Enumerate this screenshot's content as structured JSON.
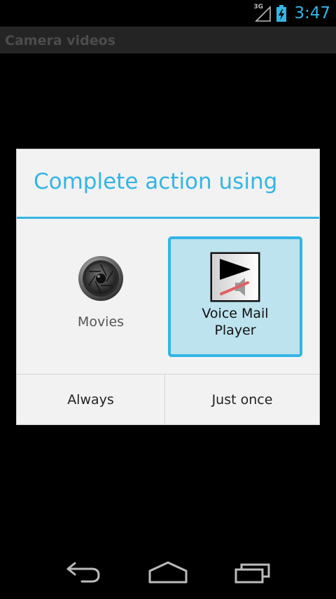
{
  "status_bar": {
    "network_type": "3G",
    "time": "3:47",
    "accent_color": "#33b5e5"
  },
  "action_bar": {
    "title": "Camera videos"
  },
  "dialog": {
    "title": "Complete action using",
    "apps": [
      {
        "label": "Movies",
        "icon": "movies-icon",
        "selected": false
      },
      {
        "label": "Voice Mail\nPlayer",
        "icon": "voice-mail-player-icon",
        "selected": true
      }
    ],
    "buttons": {
      "always": "Always",
      "just_once": "Just once"
    },
    "selection_color": "#bde3ee"
  },
  "nav_bar": {
    "icons": [
      "back-icon",
      "home-icon",
      "recent-apps-icon"
    ]
  }
}
